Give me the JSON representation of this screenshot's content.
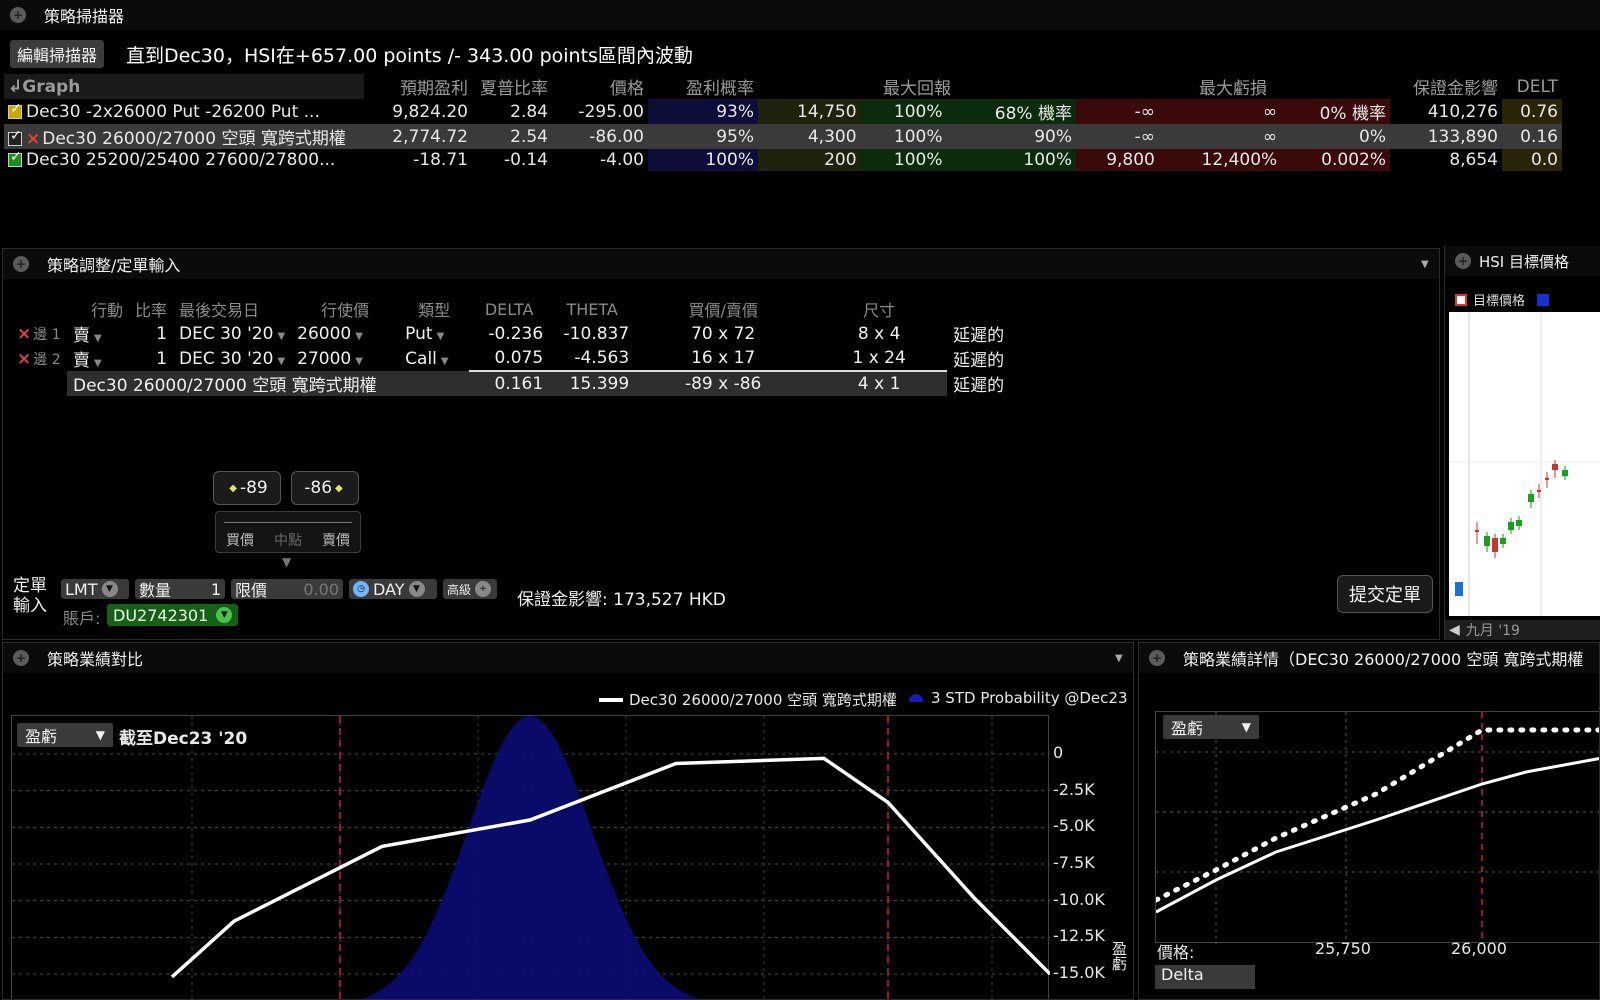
{
  "scanner": {
    "title": "策略掃描器",
    "edit_button": "編輯掃描器",
    "description": "直到Dec30，HSI在+657.00 points /- 343.00 points區間內波動",
    "columns": {
      "graph": "Graph",
      "expected_profit": "預期盈利",
      "sharpe": "夏普比率",
      "price": "價格",
      "profit_prob": "盈利概率",
      "max_return": "最大回報",
      "max_loss": "最大虧損",
      "margin_impact": "保證金影響",
      "delta": "DELT"
    },
    "rows": [
      {
        "name": "Dec30 -2x26000 Put -26200 Put ...",
        "exp": "9,824.20",
        "sharpe": "2.84",
        "price": "-295.00",
        "prob": "93%",
        "mr1": "14,750",
        "mr2": "100%",
        "mr3": "68%",
        "mr_suffix": "機率",
        "ml1": "-∞",
        "ml2": "∞",
        "ml3": "0%",
        "ml_suffix": "機率",
        "margin": "410,276",
        "delta": "0.76",
        "check": "yellow"
      },
      {
        "name": "Dec30 26000/27000 空頭 寬跨式期權",
        "exp": "2,774.72",
        "sharpe": "2.54",
        "price": "-86.00",
        "prob": "95%",
        "mr1": "4,300",
        "mr2": "100%",
        "mr3": "90%",
        "mr_suffix": "",
        "ml1": "-∞",
        "ml2": "∞",
        "ml3": "0%",
        "ml_suffix": "",
        "margin": "133,890",
        "delta": "0.16",
        "check": "white"
      },
      {
        "name": "Dec30 25200/25400 27600/27800...",
        "exp": "-18.71",
        "sharpe": "-0.14",
        "price": "-4.00",
        "prob": "100%",
        "mr1": "200",
        "mr2": "100%",
        "mr3": "100%",
        "mr_suffix": "",
        "ml1": "9,800",
        "ml2": "12,400%",
        "ml3": "0.002%",
        "ml_suffix": "",
        "margin": "8,654",
        "delta": "0.0",
        "check": "green"
      }
    ]
  },
  "adjust": {
    "title": "策略調整/定單輸入",
    "headers": {
      "action": "行動",
      "ratio": "比率",
      "last_trade": "最後交易日",
      "strike": "行使價",
      "type": "類型",
      "delta": "DELTA",
      "theta": "THETA",
      "bid_ask": "買價/賣價",
      "size": "尺寸"
    },
    "legs": [
      {
        "label": "邊 1",
        "action": "賣",
        "ratio": "1",
        "date": "DEC 30 '20",
        "strike": "26000",
        "type": "Put",
        "delta": "-0.236",
        "theta": "-10.837",
        "bidask": "70 x 72",
        "size": "8 x 4",
        "status": "延遲的"
      },
      {
        "label": "邊 2",
        "action": "賣",
        "ratio": "1",
        "date": "DEC 30 '20",
        "strike": "27000",
        "type": "Call",
        "delta": "0.075",
        "theta": "-4.563",
        "bidask": "16 x 17",
        "size": "1 x 24",
        "status": "延遲的"
      }
    ],
    "combo": {
      "name": "Dec30 26000/27000 空頭 寬跨式期權",
      "delta": "0.161",
      "theta": "15.399",
      "bidask": "-89 x -86",
      "size": "4 x 1",
      "status": "延遲的"
    },
    "bid_box": "-89",
    "ask_box": "-86",
    "slider_labels": {
      "bid": "買價",
      "mid": "中點",
      "ask": "賣價"
    },
    "order_label_line1": "定單",
    "order_label_line2": "輸入",
    "order_type": "LMT",
    "qty_label": "數量",
    "qty_value": "1",
    "limit_label": "限價",
    "limit_value": "0.00",
    "tif": "DAY",
    "advanced": "高級",
    "account_label": "賬戶:",
    "account": "DU2742301",
    "margin_text": "保證金影響: 173,527 HKD",
    "submit": "提交定單"
  },
  "hsi": {
    "title": "HSI 目標價格",
    "legend_target": "目標價格",
    "footer": "九月 '19"
  },
  "performance": {
    "title": "策略業績對比",
    "legend_series": "Dec30 26000/27000 空頭 寬跨式期權",
    "legend_prob": "3 STD Probability @Dec23",
    "dropdown": "盈虧",
    "asof": "截至Dec23 '20",
    "yticks": [
      "0",
      "-2.5K",
      "-5.0K",
      "-7.5K",
      "-10.0K",
      "-12.5K",
      "-15.0K"
    ],
    "ylabel": "盈虧"
  },
  "detail": {
    "title": "策略業績詳情（DEC30 26000/27000 空頭 寬跨式期權",
    "dropdown": "盈虧",
    "xlabel": "價格:",
    "xticks": [
      "25,750",
      "26,000"
    ],
    "delta_dropdown": "Delta"
  },
  "chart_data": {
    "type": "line",
    "title": "",
    "xlabel": "",
    "ylabel": "盈虧",
    "ylim": [
      -15000,
      0
    ],
    "yticks": [
      0,
      -2500,
      -5000,
      -7500,
      -10000,
      -12500,
      -15000
    ],
    "grid": true,
    "legend_placement": "top-right",
    "series": [
      {
        "name": "Dec30 26000/27000 空頭 寬跨式期權",
        "points_y": [
          -15200,
          -11400,
          -6300,
          -4500,
          -650,
          -300,
          -3300,
          -9800,
          -15000
        ]
      }
    ],
    "probability_area": {
      "name": "3 STD Probability @Dec23",
      "color": "#0b0b6e"
    }
  },
  "colors": {
    "accent_green": "#1d8f1d",
    "loss_red": "#3a0a0a",
    "profit_green": "#0c2a0c",
    "prob_blue": "#0b0b6e",
    "strike_red": "#d42020"
  }
}
